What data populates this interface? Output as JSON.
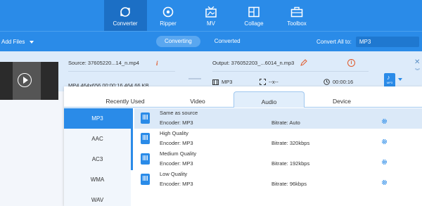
{
  "nav": {
    "items": [
      {
        "label": "Converter",
        "icon": "converter-icon",
        "active": true
      },
      {
        "label": "Ripper",
        "icon": "ripper-icon",
        "active": false
      },
      {
        "label": "MV",
        "icon": "mv-icon",
        "active": false
      },
      {
        "label": "Collage",
        "icon": "collage-icon",
        "active": false
      },
      {
        "label": "Toolbox",
        "icon": "toolbox-icon",
        "active": false
      }
    ]
  },
  "toolbar": {
    "add_files": "Add Files",
    "converting": "Converting",
    "converted": "Converted",
    "convert_all_label": "Convert All to:",
    "convert_all_value": "MP3"
  },
  "file": {
    "source": "Source: 37605220...14_n.mp4",
    "source_meta": "MP4   464x656   00:00:16   464.66 KB",
    "output": "Output: 376052203_...6014_n.mp3",
    "out_format": "MP3",
    "out_res": "--x--",
    "out_duration": "00:00:16",
    "out_duration2": "00:00:16",
    "format_badge": "MP3"
  },
  "tabs": [
    "Recently Used",
    "Video",
    "Audio",
    "Device"
  ],
  "active_tab": "Audio",
  "categories": [
    "MP3",
    "AAC",
    "AC3",
    "WMA",
    "WAV"
  ],
  "active_category": "MP3",
  "presets": [
    {
      "name": "Same as source",
      "encoder": "Encoder: MP3",
      "bitrate": "Bitrate: Auto"
    },
    {
      "name": "High Quality",
      "encoder": "Encoder: MP3",
      "bitrate": "Bitrate: 320kbps"
    },
    {
      "name": "Medium Quality",
      "encoder": "Encoder: MP3",
      "bitrate": "Bitrate: 192kbps"
    },
    {
      "name": "Low Quality",
      "encoder": "Encoder: MP3",
      "bitrate": "Bitrate: 96kbps"
    }
  ],
  "colors": {
    "accent": "#2a8be8",
    "nav_active": "#1c6fc5",
    "warning": "#e05a2b"
  }
}
